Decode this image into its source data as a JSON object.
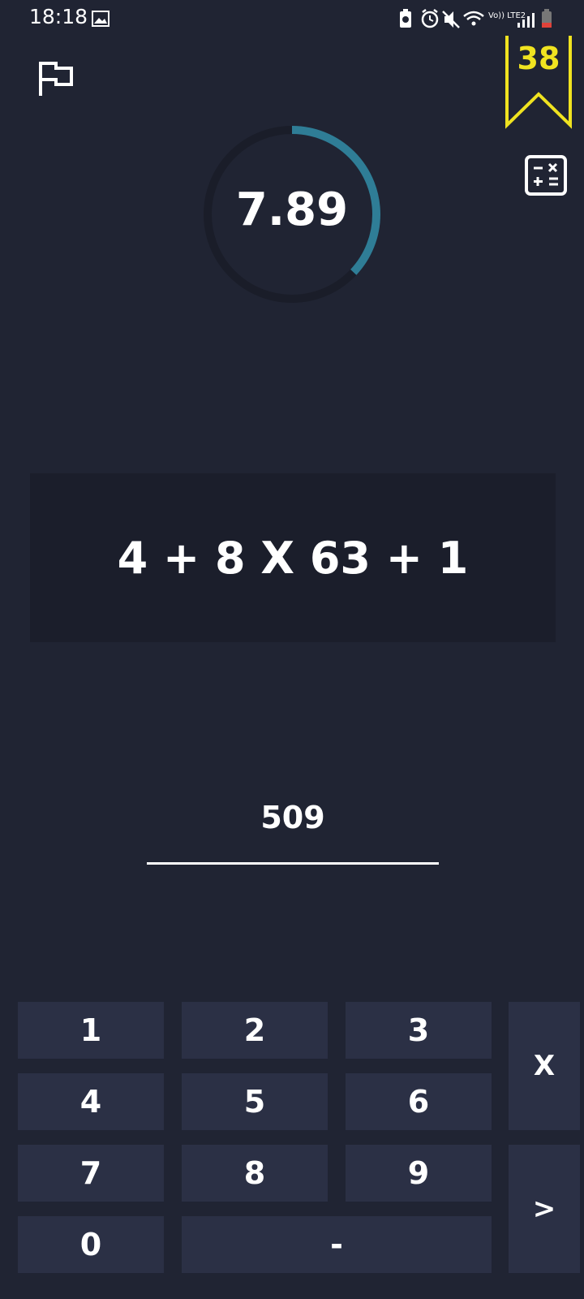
{
  "status_bar": {
    "time": "18:18",
    "network": "Vo)) LTE2"
  },
  "header": {
    "score": "38"
  },
  "timer": {
    "value": "7.89",
    "progress": 0.37,
    "ring_color": "#2f7d96",
    "track_color": "#1a1d29"
  },
  "question": {
    "text": "4 + 8 X 63 + 1"
  },
  "answer": {
    "value": "509"
  },
  "keypad": {
    "k1": "1",
    "k2": "2",
    "k3": "3",
    "k4": "4",
    "k5": "5",
    "k6": "6",
    "k7": "7",
    "k8": "8",
    "k9": "9",
    "k0": "0",
    "minus": "-",
    "clear": "X",
    "submit": ">"
  },
  "colors": {
    "background": "#202433",
    "key": "#2b3045",
    "score": "#f0e320"
  },
  "icons": [
    "flag-icon",
    "bookmark-icon",
    "calculator-icon",
    "gallery-icon",
    "battery-icon",
    "alarm-icon",
    "mute-icon",
    "wifi-icon",
    "signal-icon"
  ]
}
